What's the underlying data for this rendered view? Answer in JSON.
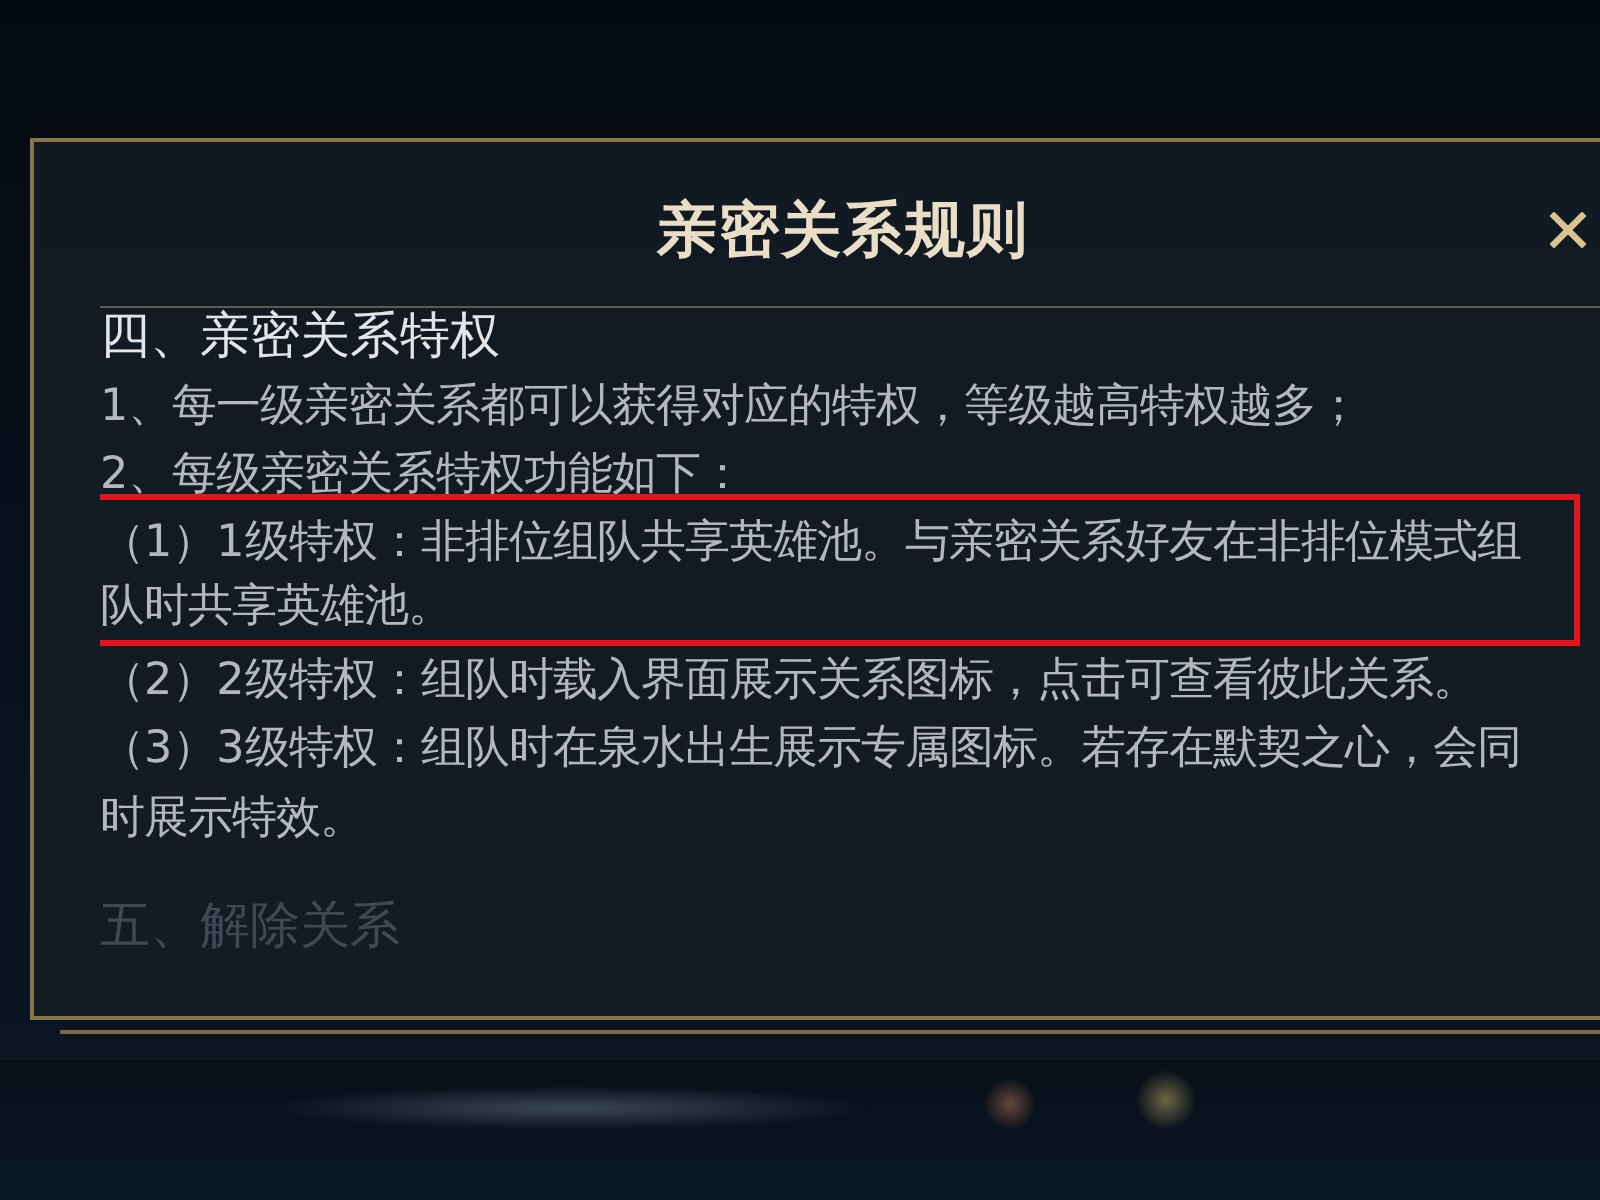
{
  "dialog": {
    "title": "亲密关系规则",
    "rules": [
      {
        "kind": "heading",
        "text": "四、亲密关系特权",
        "highlighted": false,
        "faded": false
      },
      {
        "kind": "item",
        "text": "1、每一级亲密关系都可以获得对应的特权，等级越高特权越多；",
        "highlighted": false,
        "faded": false
      },
      {
        "kind": "item",
        "text": "2、每级亲密关系特权功能如下：",
        "highlighted": false,
        "faded": false
      },
      {
        "kind": "item",
        "text": "（1）1级特权：非排位组队共享英雄池。与亲密关系好友在非排位模式组队时共享英雄池。",
        "highlighted": true,
        "faded": false
      },
      {
        "kind": "item",
        "text": "（2）2级特权：组队时载入界面展示关系图标，点击可查看彼此关系。",
        "highlighted": false,
        "faded": false
      },
      {
        "kind": "item",
        "text": "（3）3级特权：组队时在泉水出生展示专属图标。若存在默契之心，会同时展示特效。",
        "highlighted": false,
        "faded": false
      },
      {
        "kind": "heading",
        "text": "五、解除关系",
        "highlighted": false,
        "faded": true
      }
    ]
  }
}
